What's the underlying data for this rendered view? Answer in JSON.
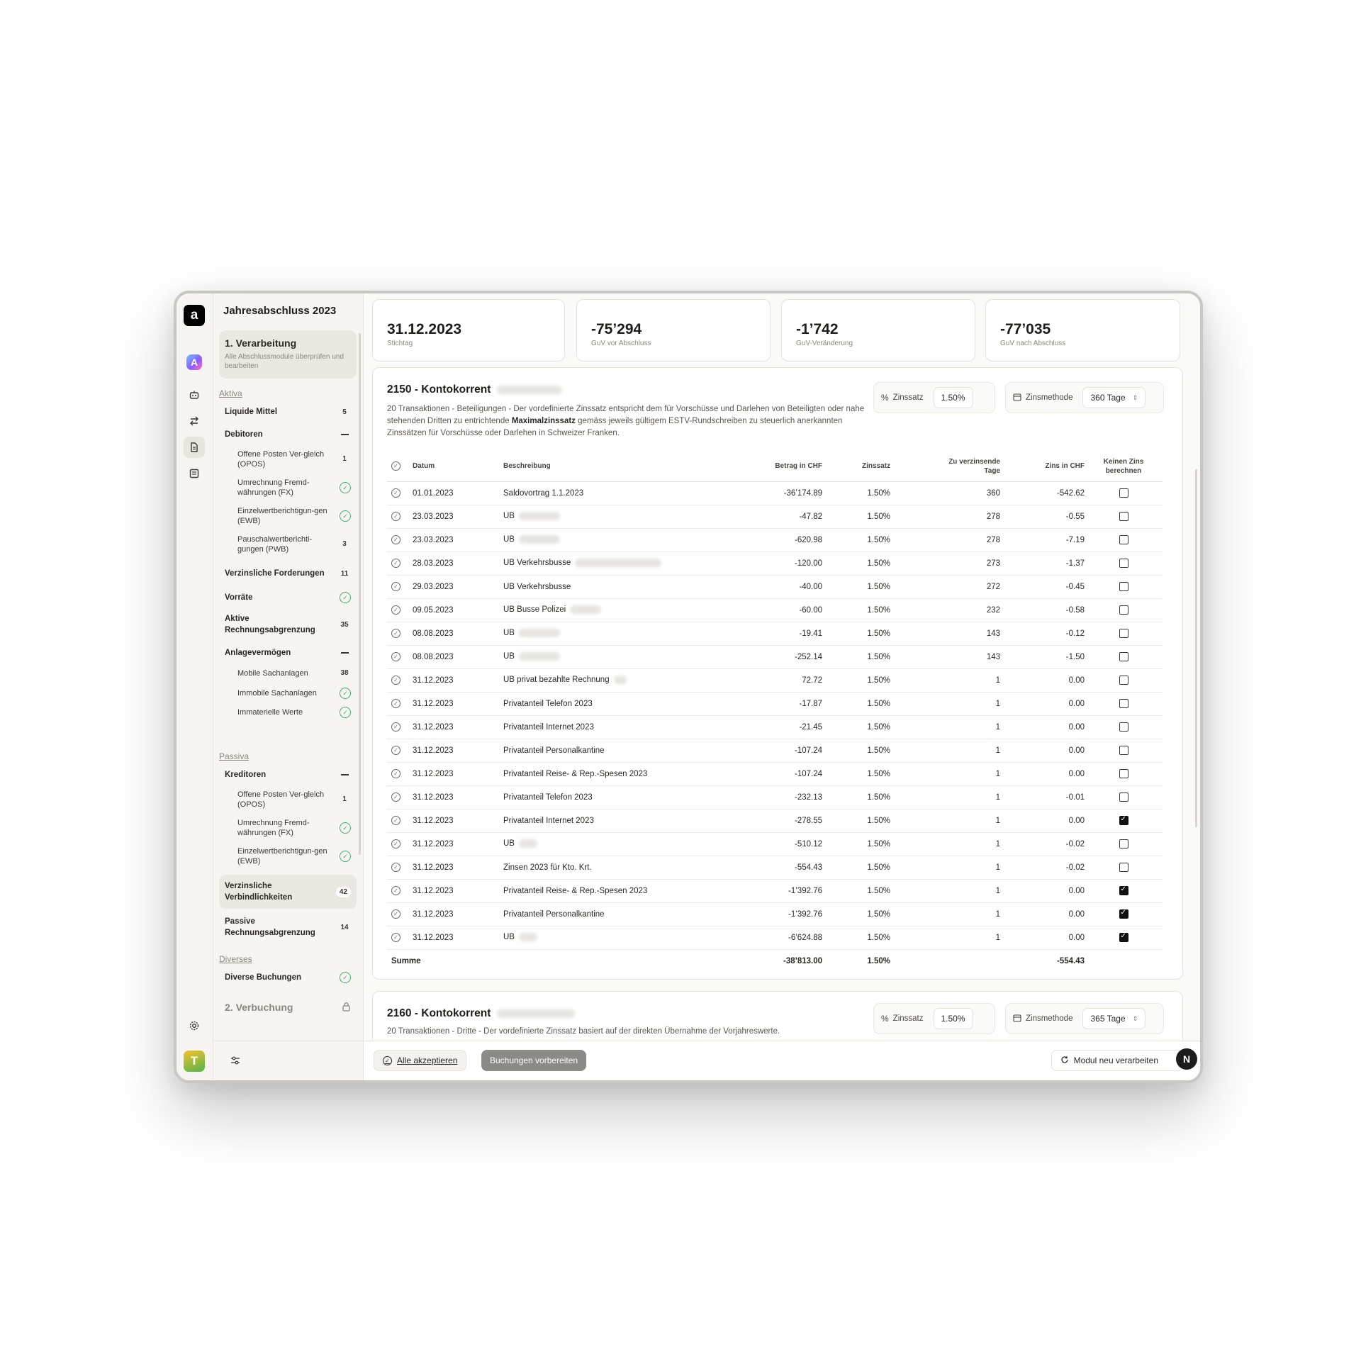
{
  "app": {
    "title": "Jahresabschluss 2023",
    "logo_letter": "a",
    "user_initial": "T",
    "ai_letter": "A",
    "n_badge": "N"
  },
  "step1": {
    "title": "1. Verarbeitung",
    "subtitle": "Alle Abschlussmodule überprüfen und bearbeiten"
  },
  "step2": {
    "title": "2. Verbuchung"
  },
  "sidebar": {
    "aktiva_label": "Aktiva",
    "passiva_label": "Passiva",
    "diverses_label": "Diverses",
    "items": [
      {
        "label": "Liquide Mittel",
        "count": "5"
      },
      {
        "label": "Debitoren"
      },
      {
        "label": "Offene Posten Ver-gleich (OPOS)",
        "count": "1"
      },
      {
        "label": "Umrechnung Fremd-währungen (FX)"
      },
      {
        "label": "Einzelwertberichtigun-gen (EWB)"
      },
      {
        "label": "Pauschalwertberichti-gungen (PWB)",
        "count": "3"
      },
      {
        "label": "Verzinsliche Forderungen",
        "count": "11"
      },
      {
        "label": "Vorräte"
      },
      {
        "label": "Aktive Rechnungsabgrenzung",
        "count": "35"
      },
      {
        "label": "Anlagevermögen"
      },
      {
        "label": "Mobile Sachanlagen",
        "count": "38"
      },
      {
        "label": "Immobile Sachanlagen"
      },
      {
        "label": "Immaterielle Werte"
      },
      {
        "label": "Kreditoren"
      },
      {
        "label": "Offene Posten Ver-gleich (OPOS)",
        "count": "1"
      },
      {
        "label": "Umrechnung Fremd-währungen (FX)"
      },
      {
        "label": "Einzelwertberichtigun-gen (EWB)"
      },
      {
        "label": "Verzinsliche Verbindlichkeiten",
        "count": "42"
      },
      {
        "label": "Passive Rechnungsabgrenzung",
        "count": "14"
      },
      {
        "label": "Diverse Buchungen"
      }
    ]
  },
  "kpis": [
    {
      "value": "31.12.2023",
      "label": "Stichtag"
    },
    {
      "value": "-75’294",
      "label": "GuV vor Abschluss"
    },
    {
      "value": "-1’742",
      "label": "GuV-Veränderung"
    },
    {
      "value": "-77’035",
      "label": "GuV nach Abschluss"
    }
  ],
  "panel1": {
    "title": "2150 - Kontokorrent",
    "desc_part1": "20 Transaktionen - Beteiligungen - Der vordefinierte Zinssatz entspricht dem für Vorschüsse und Darlehen von Beteiligten oder nahe stehenden Dritten zu entrichtende ",
    "desc_bold": "Maximalzinssatz",
    "desc_part2": " gemäss jeweils gültigem ESTV-Rundschreiben zu steuerlich anerkannten Zinssätzen für Vorschüsse oder Darlehen in Schweizer Franken.",
    "zinssatz_label": "Zinssatz",
    "zinssatz_value": "1.50%",
    "zinsmethode_label": "Zinsmethode",
    "zinsmethode_value": "360 Tage",
    "columns": [
      "Datum",
      "Beschreibung",
      "Betrag in CHF",
      "Zinssatz",
      "Zu verzinsende Tage",
      "Zins in CHF",
      "Keinen Zins berechnen"
    ],
    "rows": [
      {
        "date": "01.01.2023",
        "desc": "Saldovortrag 1.1.2023",
        "amount": "-36’174.89",
        "rate": "1.50%",
        "days": "360",
        "interest": "-542.62",
        "no_interest": false
      },
      {
        "date": "23.03.2023",
        "desc": "UB",
        "amount": "-47.82",
        "rate": "1.50%",
        "days": "278",
        "interest": "-0.55",
        "no_interest": false
      },
      {
        "date": "23.03.2023",
        "desc": "UB",
        "amount": "-620.98",
        "rate": "1.50%",
        "days": "278",
        "interest": "-7.19",
        "no_interest": false
      },
      {
        "date": "28.03.2023",
        "desc": "UB Verkehrsbusse",
        "amount": "-120.00",
        "rate": "1.50%",
        "days": "273",
        "interest": "-1.37",
        "no_interest": false
      },
      {
        "date": "29.03.2023",
        "desc": "UB Verkehrsbusse",
        "amount": "-40.00",
        "rate": "1.50%",
        "days": "272",
        "interest": "-0.45",
        "no_interest": false
      },
      {
        "date": "09.05.2023",
        "desc": "UB Busse Polizei",
        "amount": "-60.00",
        "rate": "1.50%",
        "days": "232",
        "interest": "-0.58",
        "no_interest": false
      },
      {
        "date": "08.08.2023",
        "desc": "UB",
        "amount": "-19.41",
        "rate": "1.50%",
        "days": "143",
        "interest": "-0.12",
        "no_interest": false
      },
      {
        "date": "08.08.2023",
        "desc": "UB",
        "amount": "-252.14",
        "rate": "1.50%",
        "days": "143",
        "interest": "-1.50",
        "no_interest": false
      },
      {
        "date": "31.12.2023",
        "desc": "UB privat bezahlte Rechnung",
        "amount": "72.72",
        "rate": "1.50%",
        "days": "1",
        "interest": "0.00",
        "no_interest": false
      },
      {
        "date": "31.12.2023",
        "desc": "Privatanteil Telefon 2023",
        "amount": "-17.87",
        "rate": "1.50%",
        "days": "1",
        "interest": "0.00",
        "no_interest": false
      },
      {
        "date": "31.12.2023",
        "desc": "Privatanteil Internet 2023",
        "amount": "-21.45",
        "rate": "1.50%",
        "days": "1",
        "interest": "0.00",
        "no_interest": false
      },
      {
        "date": "31.12.2023",
        "desc": "Privatanteil Personalkantine",
        "amount": "-107.24",
        "rate": "1.50%",
        "days": "1",
        "interest": "0.00",
        "no_interest": false
      },
      {
        "date": "31.12.2023",
        "desc": "Privatanteil Reise- & Rep.-Spesen 2023",
        "amount": "-107.24",
        "rate": "1.50%",
        "days": "1",
        "interest": "0.00",
        "no_interest": false
      },
      {
        "date": "31.12.2023",
        "desc": "Privatanteil Telefon 2023",
        "amount": "-232.13",
        "rate": "1.50%",
        "days": "1",
        "interest": "-0.01",
        "no_interest": false
      },
      {
        "date": "31.12.2023",
        "desc": "Privatanteil Internet 2023",
        "amount": "-278.55",
        "rate": "1.50%",
        "days": "1",
        "interest": "0.00",
        "no_interest": true
      },
      {
        "date": "31.12.2023",
        "desc": "UB",
        "amount": "-510.12",
        "rate": "1.50%",
        "days": "1",
        "interest": "-0.02",
        "no_interest": false
      },
      {
        "date": "31.12.2023",
        "desc": "Zinsen 2023 für Kto. Krt.",
        "amount": "-554.43",
        "rate": "1.50%",
        "days": "1",
        "interest": "-0.02",
        "no_interest": false
      },
      {
        "date": "31.12.2023",
        "desc": "Privatanteil Reise- & Rep.-Spesen 2023",
        "amount": "-1’392.76",
        "rate": "1.50%",
        "days": "1",
        "interest": "0.00",
        "no_interest": true
      },
      {
        "date": "31.12.2023",
        "desc": "Privatanteil Personalkantine",
        "amount": "-1’392.76",
        "rate": "1.50%",
        "days": "1",
        "interest": "0.00",
        "no_interest": true
      },
      {
        "date": "31.12.2023",
        "desc": "UB",
        "amount": "-6’624.88",
        "rate": "1.50%",
        "days": "1",
        "interest": "0.00",
        "no_interest": true
      }
    ],
    "sum": {
      "label": "Summe",
      "amount": "-38’813.00",
      "rate": "1.50%",
      "interest": "-554.43"
    }
  },
  "panel2": {
    "title": "2160 - Kontokorrent",
    "desc": "20 Transaktionen - Dritte - Der vordefinierte Zinssatz basiert auf der direkten Übernahme der Vorjahreswerte.",
    "zinssatz_label": "Zinssatz",
    "zinssatz_value": "1.50%",
    "zinsmethode_label": "Zinsmethode",
    "zinsmethode_value": "365 Tage"
  },
  "actions": {
    "accept_all": "Alle akzeptieren",
    "prepare": "Buchungen vorbereiten",
    "reprocess": "Modul neu verarbeiten"
  },
  "icons": [
    "logo-icon",
    "ai-assistant-icon",
    "robot-icon",
    "transfer-icon",
    "document-icon",
    "list-icon",
    "settings-icon",
    "filter-icon",
    "lock-icon",
    "check-circle-icon",
    "percent-icon",
    "calendar-icon",
    "chevron-updown-icon",
    "refresh-icon"
  ]
}
